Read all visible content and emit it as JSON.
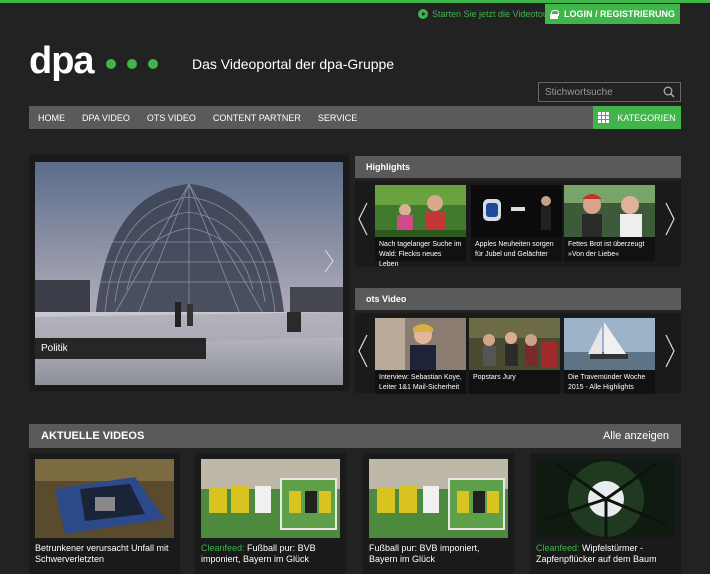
{
  "top": {
    "videotour": "Starten Sie jetzt die Videotour",
    "login": "LOGIN / REGISTRIERUNG"
  },
  "brand": {
    "logo": "dpa",
    "tagline": "Das Videoportal der dpa-Gruppe",
    "accent": "#3fb54a"
  },
  "search": {
    "placeholder": "Stichwortsuche"
  },
  "nav": {
    "items": [
      "HOME",
      "DPA VIDEO",
      "OTS VIDEO",
      "CONTENT PARTNER",
      "SERVICE"
    ],
    "categories": "KATEGORIEN"
  },
  "hero": {
    "caption": "Politik"
  },
  "highlights": {
    "title": "Highlights",
    "items": [
      {
        "line1": "Nach tagelanger Suche im",
        "line2": "Wald: Fleckis neues Leben"
      },
      {
        "line1": "Apples Neuheiten sorgen",
        "line2": "für Jubel und Gelächter"
      },
      {
        "line1": "Fettes Brot ist überzeugt",
        "line2": "»Von der Liebe«"
      }
    ]
  },
  "ots": {
    "title": "ots Video",
    "items": [
      {
        "line1": "Interview: Sebastian Koye,",
        "line2": "Leiter 1&1 Mail-Sicherheit"
      },
      {
        "line1": "Popstars Jury",
        "line2": ""
      },
      {
        "line1": "Die Travemünder Woche",
        "line2": "2015 - Alle Highlights"
      }
    ]
  },
  "aktuelle": {
    "title": "AKTUELLE VIDEOS",
    "all": "Alle anzeigen",
    "cards": [
      {
        "prefix": "",
        "line1": "Betrunkener verursacht Unfall mit",
        "line2": "Schwerverletzten"
      },
      {
        "prefix": "Cleanfeed:",
        "line1": " Fußball pur: BVB",
        "line2": "imponiert, Bayern im Glück"
      },
      {
        "prefix": "",
        "line1": "Fußball pur: BVB imponiert,",
        "line2": "Bayern im Glück"
      },
      {
        "prefix": "Cleanfeed:",
        "line1": " Wipfelstürmer -",
        "line2": "Zapfenpflücker auf dem Baum"
      }
    ]
  }
}
